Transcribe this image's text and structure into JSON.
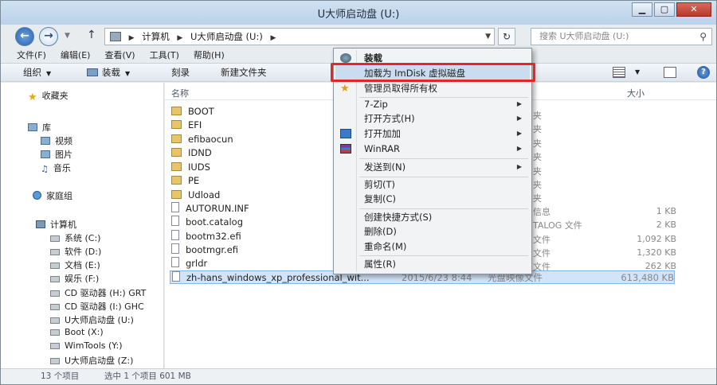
{
  "window": {
    "title": "U大师启动盘 (U:)"
  },
  "address": {
    "crumbs": [
      "计算机",
      "U大师启动盘 (U:)"
    ]
  },
  "search": {
    "placeholder": "搜索 U大师启动盘 (U:)"
  },
  "menubar": [
    "文件(F)",
    "编辑(E)",
    "查看(V)",
    "工具(T)",
    "帮助(H)"
  ],
  "toolbar": {
    "organize": "组织",
    "mount": "装载",
    "burn": "刻录",
    "new_folder": "新建文件夹"
  },
  "navpane": {
    "favorites": "收藏夹",
    "libraries": "库",
    "lib_items": [
      "视频",
      "图片",
      "音乐"
    ],
    "homegroup": "家庭组",
    "computer": "计算机",
    "drives": [
      "系统 (C:)",
      "软件 (D:)",
      "文档 (E:)",
      "娱乐 (F:)",
      "CD 驱动器 (H:) GRT",
      "CD 驱动器 (I:) GHC",
      "U大师启动盘 (U:)",
      "Boot (X:)",
      "WimTools (Y:)",
      "U大师启动盘 (Z:)"
    ]
  },
  "columns": {
    "name": "名称",
    "size": "大小"
  },
  "files": [
    {
      "name": "BOOT",
      "type": "folder"
    },
    {
      "name": "EFI",
      "type": "folder"
    },
    {
      "name": "efibaocun",
      "type": "folder"
    },
    {
      "name": "IDND",
      "type": "folder"
    },
    {
      "name": "IUDS",
      "type": "folder"
    },
    {
      "name": "PE",
      "type": "folder"
    },
    {
      "name": "Udload",
      "type": "folder"
    },
    {
      "name": "AUTORUN.INF",
      "type": "file"
    },
    {
      "name": "boot.catalog",
      "type": "file"
    },
    {
      "name": "bootm32.efi",
      "type": "file"
    },
    {
      "name": "bootmgr.efi",
      "type": "file"
    },
    {
      "name": "grldr",
      "type": "file"
    },
    {
      "name": "zh-hans_windows_xp_professional_wit...",
      "type": "file",
      "date": "2015/6/23 8:44",
      "kind": "光盘映像文件",
      "size": "613,480 KB",
      "selected": true
    }
  ],
  "side_fragments": {
    "types": [
      "夹",
      "夹",
      "夹",
      "夹",
      "夹",
      "夹",
      "夹",
      "信息",
      "TALOG 文件",
      "文件",
      "文件",
      "文件"
    ],
    "sizes": [
      "1 KB",
      "2 KB",
      "1,092 KB",
      "1,320 KB",
      "262 KB"
    ]
  },
  "context_menu": {
    "title": "装载",
    "items": {
      "imdisk": "加载为 ImDisk 虚拟磁盘",
      "take_owner": "管理员取得所有权",
      "zip": "7-Zip",
      "open_with": "打开方式(H)",
      "open_add": "打开加加",
      "winrar": "WinRAR",
      "send_to": "发送到(N)",
      "cut": "剪切(T)",
      "copy": "复制(C)",
      "shortcut": "创建快捷方式(S)",
      "delete": "删除(D)",
      "rename": "重命名(M)",
      "properties": "属性(R)"
    }
  },
  "status": {
    "count": "13 个项目",
    "selected": "选中 1 个项目 601 MB"
  }
}
